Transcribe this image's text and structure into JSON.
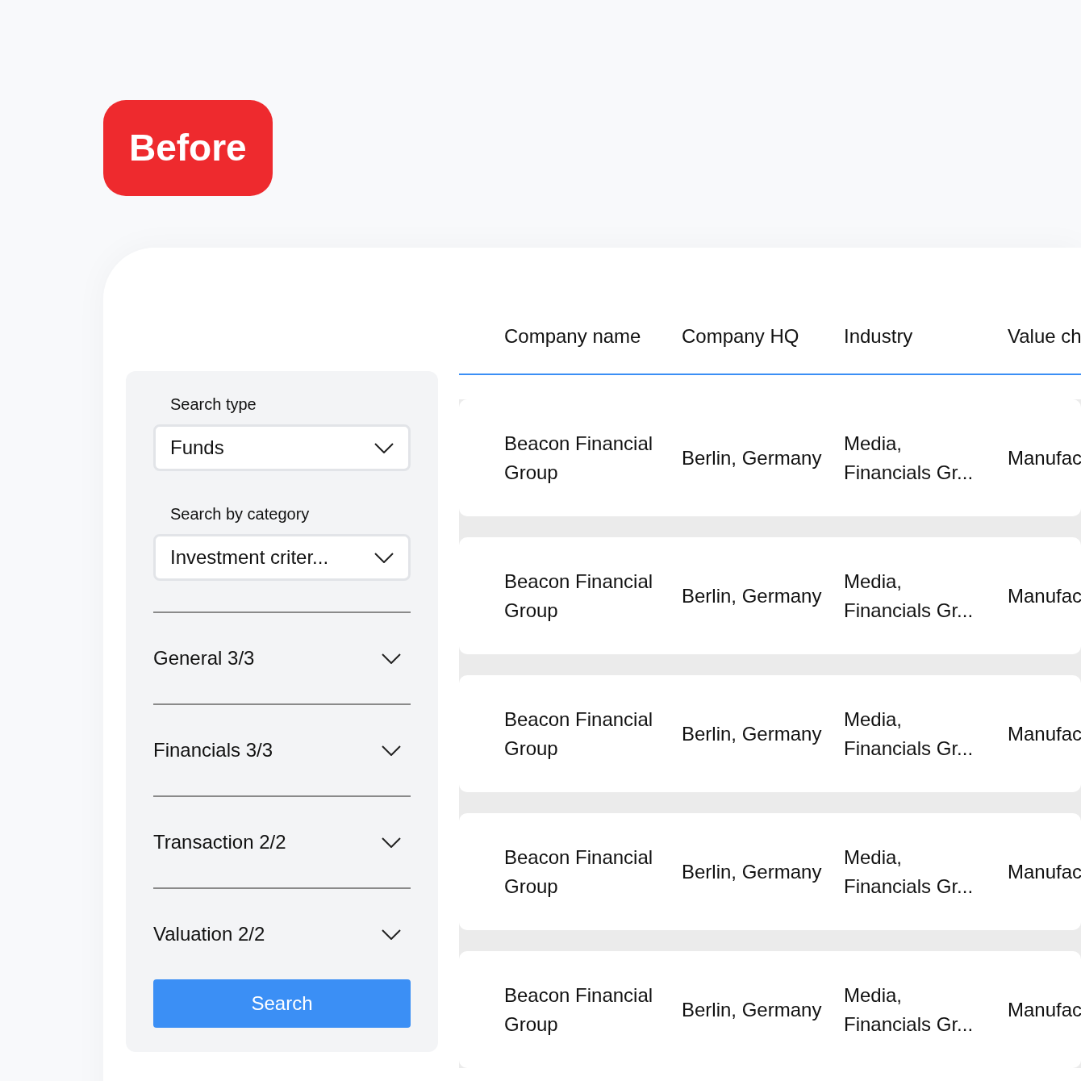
{
  "badge": "Before",
  "filters": {
    "fields": [
      {
        "label": "Search type",
        "value": "Funds"
      },
      {
        "label": "Search by category",
        "value": "Investment criter..."
      }
    ],
    "sections": [
      "General 3/3",
      "Financials 3/3",
      "Transaction 2/2",
      "Valuation 2/2"
    ],
    "button": "Search"
  },
  "table": {
    "columns": [
      "Company name",
      "Company HQ",
      "Industry",
      "Value ch"
    ],
    "rows": [
      [
        "Beacon Financial Group",
        "Berlin, Germany",
        "Media, Financials Gr...",
        "Manufac"
      ],
      [
        "Beacon Financial Group",
        "Berlin, Germany",
        "Media, Financials Gr...",
        "Manufac"
      ],
      [
        "Beacon Financial Group",
        "Berlin, Germany",
        "Media, Financials Gr...",
        "Manufac"
      ],
      [
        "Beacon Financial Group",
        "Berlin, Germany",
        "Media, Financials Gr...",
        "Manufac"
      ],
      [
        "Beacon Financial Group",
        "Berlin, Germany",
        "Media, Financials Gr...",
        "Manufac"
      ]
    ]
  }
}
